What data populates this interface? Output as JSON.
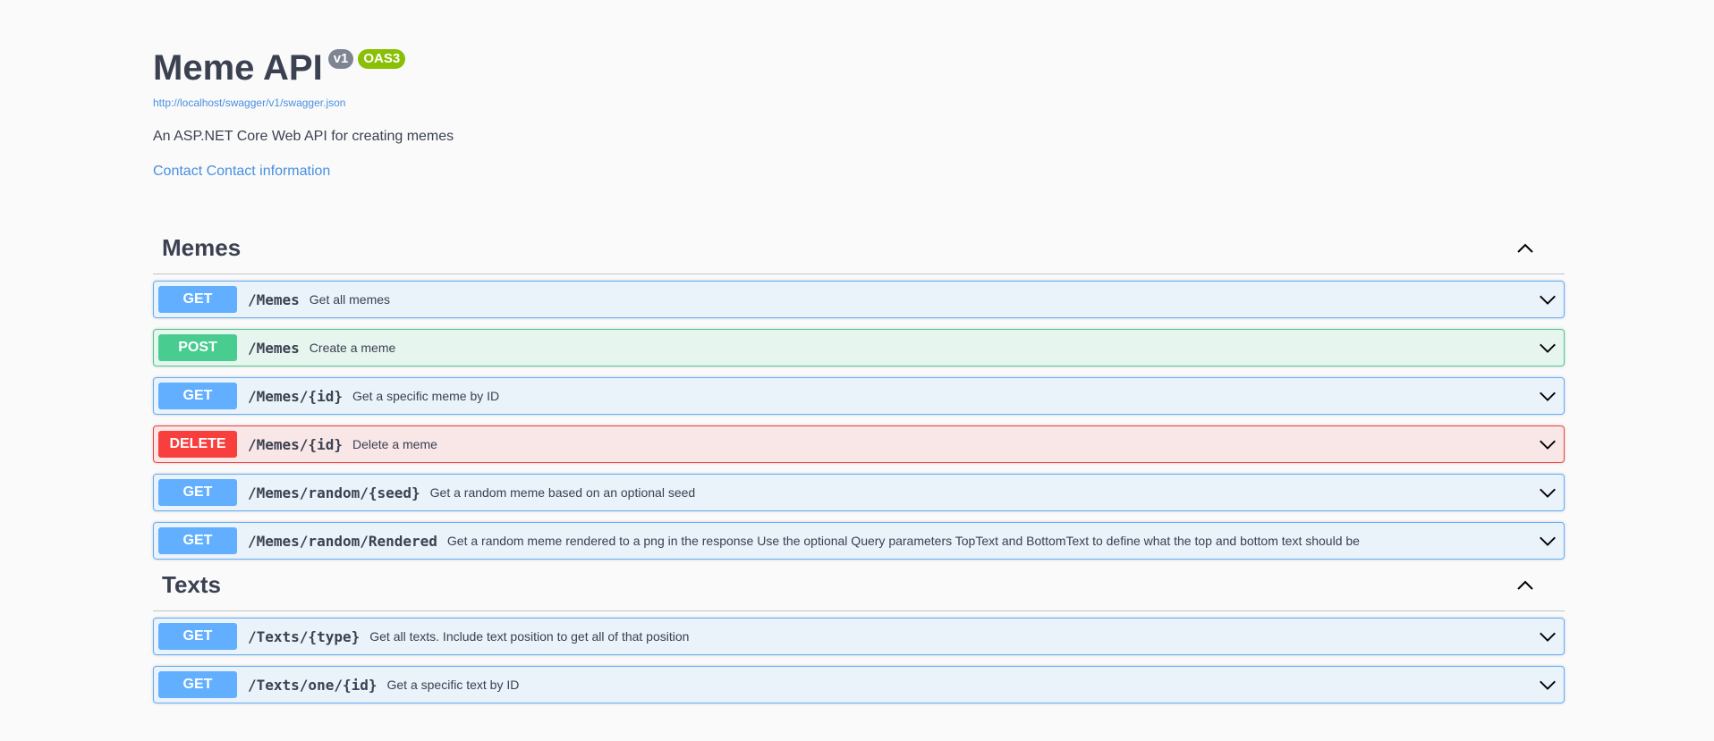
{
  "info": {
    "title": "Meme API",
    "version": "v1",
    "oas": "OAS3",
    "spec_url": "http://localhost/swagger/v1/swagger.json",
    "description": "An ASP.NET Core Web API for creating memes",
    "contact": "Contact Contact information"
  },
  "tags": [
    {
      "name": "Memes",
      "operations": [
        {
          "method": "GET",
          "path": "/Memes",
          "summary": "Get all memes"
        },
        {
          "method": "POST",
          "path": "/Memes",
          "summary": "Create a meme"
        },
        {
          "method": "GET",
          "path": "/Memes/{id}",
          "summary": "Get a specific meme by ID"
        },
        {
          "method": "DELETE",
          "path": "/Memes/{id}",
          "summary": "Delete a meme"
        },
        {
          "method": "GET",
          "path": "/Memes/random/{seed}",
          "summary": "Get a random meme based on an optional seed"
        },
        {
          "method": "GET",
          "path": "/Memes/random/Rendered",
          "summary": "Get a random meme rendered to a png in the response Use the optional Query parameters TopText and BottomText to define what the top and bottom text should be"
        }
      ]
    },
    {
      "name": "Texts",
      "operations": [
        {
          "method": "GET",
          "path": "/Texts/{type}",
          "summary": "Get all texts. Include text position to get all of that position"
        },
        {
          "method": "GET",
          "path": "/Texts/one/{id}",
          "summary": "Get a specific text by ID"
        }
      ]
    }
  ],
  "colors": {
    "get": "#61affe",
    "post": "#49cc90",
    "delete": "#f93e3e",
    "link": "#4990e2",
    "oas_badge": "#89bf04",
    "version_badge": "#7d8492"
  },
  "icons": {
    "collapse": "chevron-up-icon",
    "expand": "chevron-down-icon"
  }
}
